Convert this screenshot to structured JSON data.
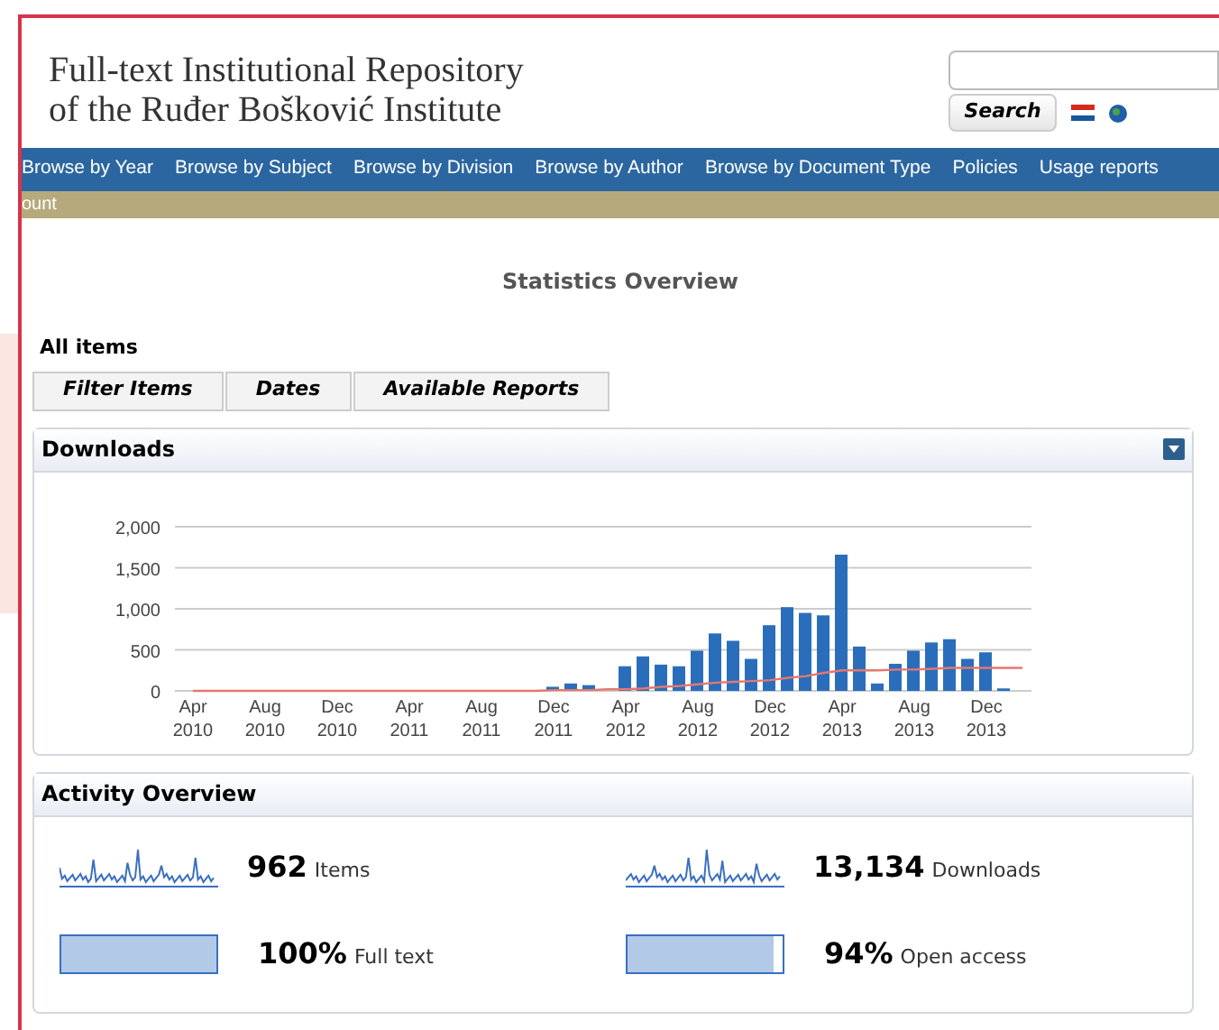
{
  "header": {
    "title_lines": [
      "Full-text Institutional Repository",
      "of the Ruđer Bošković Institute"
    ],
    "search_button": "Search"
  },
  "nav": [
    "Browse by Year",
    "Browse by Subject",
    "Browse by Division",
    "Browse by Author",
    "Browse by Document Type",
    "Policies",
    "Usage reports"
  ],
  "subnav": "ount",
  "page_title": "Statistics Overview",
  "section_label": "All items",
  "buttons": [
    "Filter Items",
    "Dates",
    "Available Reports"
  ],
  "downloads_panel": {
    "title": "Downloads",
    "chart_data": {
      "type": "bar",
      "categories": [
        "Apr 2010",
        null,
        null,
        null,
        "Aug 2010",
        null,
        null,
        null,
        "Dec 2010",
        null,
        null,
        null,
        "Apr 2011",
        null,
        null,
        null,
        "Aug 2011",
        null,
        null,
        null,
        "Dec 2011",
        null,
        null,
        null,
        "Apr 2012",
        null,
        null,
        null,
        "Aug 2012",
        null,
        null,
        null,
        "Dec 2012",
        null,
        null,
        null,
        "Apr 2013",
        null,
        null,
        null,
        "Aug 2013",
        null,
        null,
        null,
        "Dec 2013",
        null,
        null
      ],
      "series": [
        {
          "type": "bar",
          "color": "#2a6ebb",
          "values": [
            0,
            0,
            0,
            0,
            0,
            0,
            0,
            0,
            0,
            0,
            0,
            0,
            0,
            0,
            0,
            0,
            0,
            0,
            0,
            0,
            50,
            90,
            70,
            0,
            300,
            420,
            320,
            300,
            490,
            700,
            610,
            390,
            800,
            1020,
            950,
            920,
            1660,
            540,
            90,
            330,
            490,
            590,
            630,
            390,
            470,
            30,
            0
          ]
        },
        {
          "type": "line",
          "color": "#e5776e",
          "values": [
            0,
            0,
            0,
            0,
            0,
            0,
            0,
            0,
            0,
            0,
            0,
            0,
            0,
            0,
            0,
            0,
            0,
            0,
            0,
            0,
            10,
            10,
            10,
            20,
            20,
            30,
            50,
            60,
            80,
            100,
            110,
            120,
            130,
            160,
            180,
            220,
            250,
            250,
            250,
            260,
            260,
            270,
            280,
            280,
            280,
            280,
            280
          ]
        }
      ],
      "ylim": [
        0,
        2000
      ],
      "grid": true,
      "yticks": [
        {
          "value": 0,
          "label": "0"
        },
        {
          "value": 500,
          "label": "500"
        },
        {
          "value": 1000,
          "label": "1,000"
        },
        {
          "value": 1500,
          "label": "1,500"
        },
        {
          "value": 2000,
          "label": "2,000"
        }
      ]
    }
  },
  "activity_panel": {
    "title": "Activity Overview",
    "stats": [
      {
        "kind": "sparkline",
        "value": "962",
        "label": "Items"
      },
      {
        "kind": "sparkline",
        "value": "13,134",
        "label": "Downloads"
      },
      {
        "kind": "meter",
        "value": "100%",
        "label": "Full text",
        "level": 1.0
      },
      {
        "kind": "meter",
        "value": "94%",
        "label": "Open access",
        "level": 0.94
      }
    ]
  }
}
